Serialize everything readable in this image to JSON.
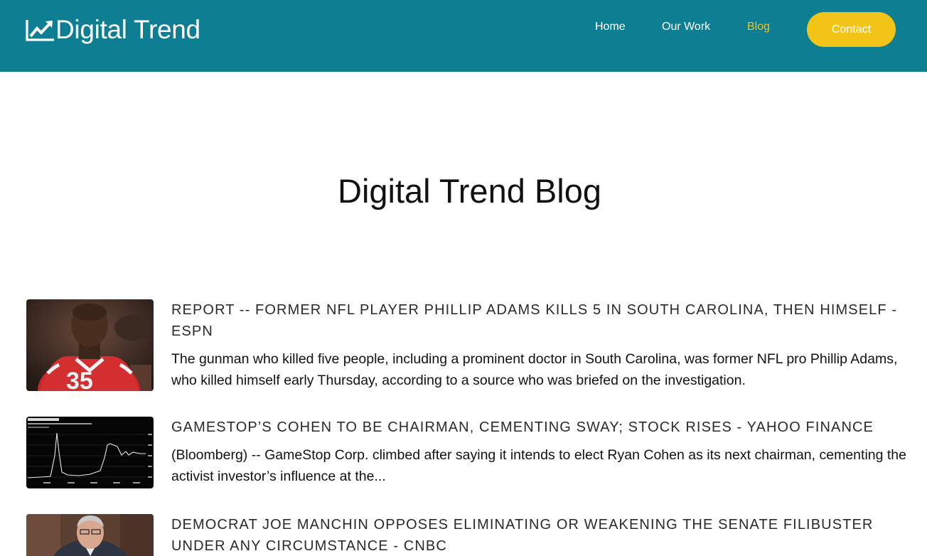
{
  "header": {
    "brand": "Digital Trend",
    "nav": [
      {
        "label": "Home"
      },
      {
        "label": "Our Work"
      },
      {
        "label": "Blog"
      }
    ],
    "contact_label": "Contact",
    "colors": {
      "bar": "#0e7f93",
      "accent": "#f2c418",
      "text": "#ffffff"
    }
  },
  "main": {
    "title": "Digital Trend Blog",
    "posts": [
      {
        "title": "Report -- Former NFL player Phillip Adams kills 5 in South Carolina, then himself - ESPN",
        "excerpt": "The gunman who killed five people, including a prominent doctor in South Carolina, was former NFL pro Phillip Adams, who killed himself early Thursday, according to a source who was briefed on the investigation."
      },
      {
        "title": "GameStop’s Cohen to Be Chairman, Cementing Sway; Stock Rises - Yahoo Finance",
        "excerpt": "(Bloomberg) -- GameStop Corp. climbed after saying it intends to elect Ryan Cohen as its next chairman, cementing the activist investor’s influence at the..."
      },
      {
        "title": "Democrat Joe Manchin opposes eliminating or weakening the Senate filibuster under any circumstance - CNBC",
        "excerpt": ""
      }
    ]
  }
}
